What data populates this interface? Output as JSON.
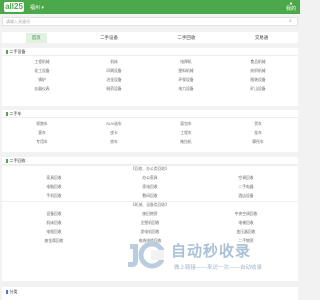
{
  "header": {
    "logo": "all25",
    "city": "福州",
    "right_label": "我的"
  },
  "search": {
    "placeholder": "请输入关键词"
  },
  "tabs": [
    "首页",
    "二手设备",
    "二手回收",
    "交易通"
  ],
  "sections": [
    {
      "title": "二手设备",
      "items": [
        "工程机械",
        "机床",
        "电焊机",
        "食品机械",
        "化工设备",
        "印刷设备",
        "塑料机械",
        "纺织机械",
        "锅炉",
        "冶金设备",
        "环保设备",
        "服装设备",
        "仪器仪表",
        "制药设备",
        "电力设备",
        "矿山设备"
      ]
    },
    {
      "title": "二手车",
      "items": [
        "轿跑车",
        "SUV选车",
        "面包车",
        "货车",
        "客车",
        "皮卡",
        "工程车",
        "挂车",
        "专用车",
        "房车",
        "拖拉机",
        "摩托车"
      ]
    },
    {
      "title": "二手回收",
      "groups": [
        {
          "subtitle": "【回收、办公类回收】",
          "items": [
            "家具回收",
            "办公家具",
            "空调回收",
            "电脑回收",
            "家电回收",
            "二手电器",
            "手机回收",
            "数码回收",
            "酒店设备"
          ]
        },
        {
          "subtitle": "【机械、设备类回收】",
          "items": [
            "设备回收",
            "废旧物资",
            "中央空调回收",
            "机床回收",
            "注塑机回收",
            "电梯回收",
            "电缆回收",
            "发电机回收",
            "变压器回收",
            "废金属回收",
            "电线电缆回收",
            "二手物资"
          ]
        }
      ]
    },
    {
      "title": "分类"
    }
  ],
  "watermark": {
    "title": "自动秒收录",
    "subtitle": "做上链接——来访一次——自动收录"
  }
}
